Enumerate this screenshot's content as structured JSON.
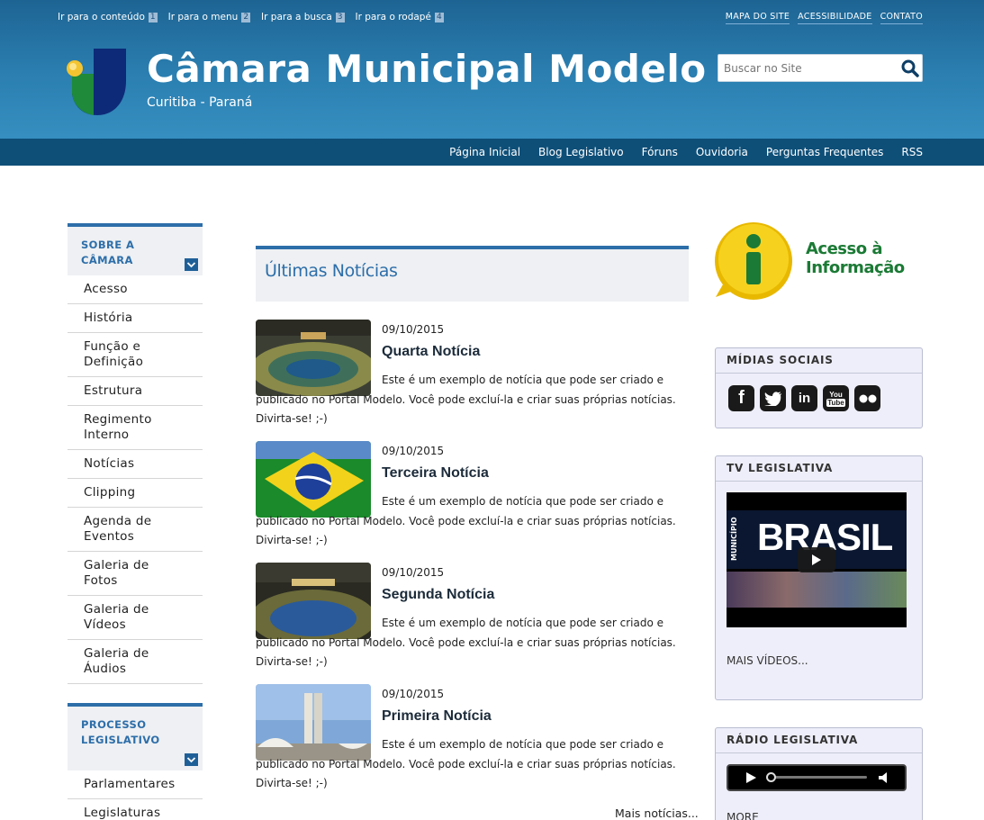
{
  "header": {
    "skip_links": [
      {
        "label": "Ir para o conteúdo",
        "key": "1"
      },
      {
        "label": "Ir para o menu",
        "key": "2"
      },
      {
        "label": "Ir para a busca",
        "key": "3"
      },
      {
        "label": "Ir para o rodapé",
        "key": "4"
      }
    ],
    "top_links": [
      "MAPA DO SITE",
      "ACESSIBILIDADE",
      "CONTATO"
    ],
    "title": "Câmara Municipal Modelo",
    "subtitle": "Curitiba - Paraná",
    "search_placeholder": "Buscar no Site",
    "nav": [
      "Página Inicial",
      "Blog Legislativo",
      "Fóruns",
      "Ouvidoria",
      "Perguntas Frequentes",
      "RSS"
    ]
  },
  "sidebar": {
    "sections": [
      {
        "title": "SOBRE A CÂMARA",
        "items": [
          "Acesso",
          "História",
          "Função e Definição",
          "Estrutura",
          "Regimento Interno",
          "Notícias",
          "Clipping",
          "Agenda de Eventos",
          "Galeria de Fotos",
          "Galeria de Vídeos",
          "Galeria de Áudios"
        ]
      },
      {
        "title": "PROCESSO LEGISLATIVO",
        "items": [
          "Parlamentares",
          "Legislaturas"
        ]
      }
    ]
  },
  "news": {
    "heading": "Últimas Notícias",
    "items": [
      {
        "date": "09/10/2015",
        "title": "Quarta Notícia",
        "body": "Este é um exemplo de notícia que pode ser criado e publicado no Portal Modelo. Você pode excluí-la e criar suas próprias notícias. Divirta-se! ;-)"
      },
      {
        "date": "09/10/2015",
        "title": "Terceira Notícia",
        "body": "Este é um exemplo de notícia que pode ser criado e publicado no Portal Modelo. Você pode excluí-la e criar suas próprias notícias. Divirta-se! ;-)"
      },
      {
        "date": "09/10/2015",
        "title": "Segunda Notícia",
        "body": "Este é um exemplo de notícia que pode ser criado e publicado no Portal Modelo. Você pode excluí-la e criar suas próprias notícias. Divirta-se! ;-)"
      },
      {
        "date": "09/10/2015",
        "title": "Primeira Notícia",
        "body": "Este é um exemplo de notícia que pode ser criado e publicado no Portal Modelo. Você pode excluí-la e criar suas próprias notícias. Divirta-se! ;-)"
      }
    ],
    "more_label": "Mais notícias..."
  },
  "right": {
    "access_info": {
      "line1": "Acesso à",
      "line2": "Informação"
    },
    "social": {
      "heading": "MÍDIAS SOCIAIS",
      "icons": [
        "facebook-icon",
        "twitter-icon",
        "linkedin-icon",
        "youtube-icon",
        "flickr-icon"
      ]
    },
    "tv": {
      "heading": "TV LEGISLATIVA",
      "video_text": "BRASIL",
      "video_side_text": "MUNICÍPIO",
      "more_label": "MAIS VÍDEOS..."
    },
    "radio": {
      "heading": "RÁDIO LEGISLATIVA",
      "more_label": "MORE"
    }
  },
  "colors": {
    "header_top": "#1d6493",
    "nav_bar": "#0e4f78",
    "accent": "#2d6ea9",
    "access_green": "#1b7a35"
  }
}
